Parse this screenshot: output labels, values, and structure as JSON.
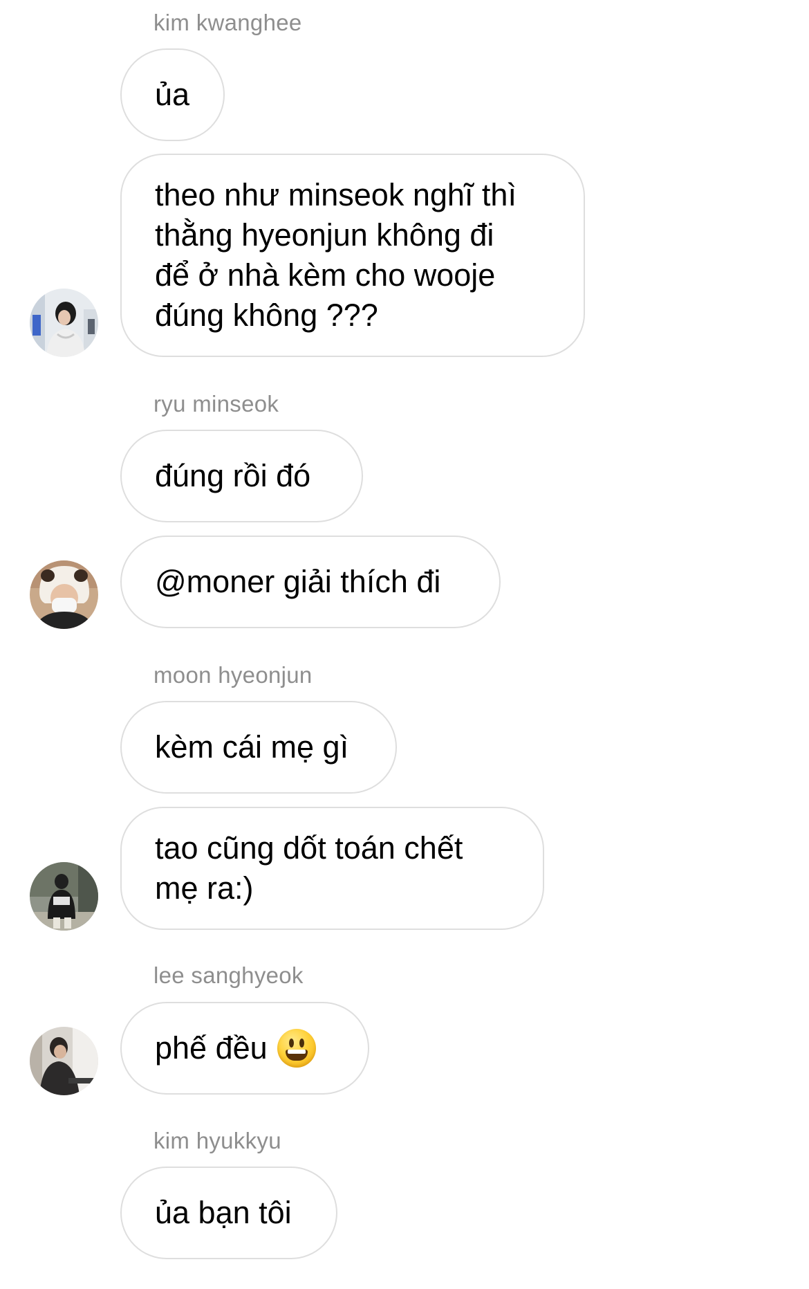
{
  "messages": [
    {
      "sender": "kim kwanghee",
      "bubbles": [
        "ủa",
        "theo như minseok nghĩ thì\nthằng hyeonjun không đi\nđể ở nhà kèm cho wooje\nđúng không ???"
      ]
    },
    {
      "sender": "ryu minseok",
      "bubbles": [
        "đúng rồi đó",
        "@moner giải thích đi"
      ]
    },
    {
      "sender": "moon hyeonjun",
      "bubbles": [
        "kèm cái mẹ gì",
        "tao cũng dốt toán chết\nmẹ ra:)"
      ]
    },
    {
      "sender": "lee sanghyeok",
      "bubbles": [
        "phế đều"
      ],
      "emoji": "grinning-face"
    },
    {
      "sender": "kim hyukkyu",
      "bubbles": [
        "ủa bạn tôi"
      ]
    }
  ],
  "colors": {
    "bubble_border": "#dedede",
    "sender_text": "#8e8e8e",
    "message_text": "#000000",
    "background": "#ffffff"
  }
}
